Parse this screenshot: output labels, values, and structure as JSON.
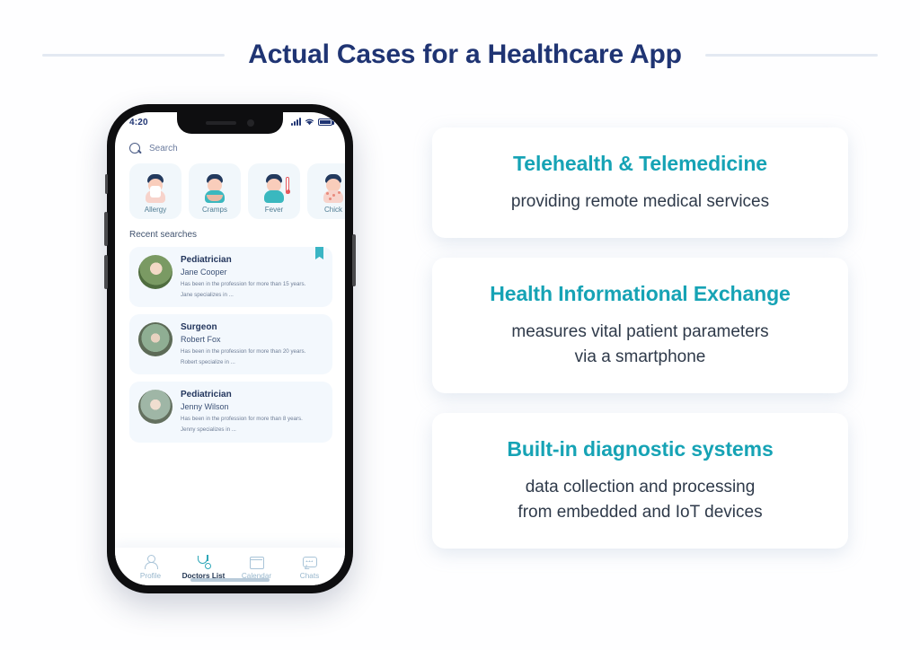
{
  "header": {
    "title": "Actual Cases for a Healthcare App"
  },
  "phone": {
    "status": {
      "time": "4:20",
      "cellular_icon": "cellular-bars-icon",
      "wifi_icon": "wifi-icon",
      "battery_icon": "battery-icon"
    },
    "search": {
      "icon": "search-icon",
      "placeholder": "Search",
      "value": ""
    },
    "symptoms": [
      {
        "label": "Allergy",
        "icon": "sneezing-boy-icon"
      },
      {
        "label": "Cramps",
        "icon": "stomach-ache-boy-icon"
      },
      {
        "label": "Fever",
        "icon": "fever-thermometer-icon"
      },
      {
        "label": "Chick",
        "icon": "chickenpox-rash-icon"
      }
    ],
    "recent": {
      "title": "Recent searches",
      "doctors": [
        {
          "specialty": "Pediatrician",
          "name": "Jane Cooper",
          "desc_line1": "Has been in the profession for more than 15 years.",
          "desc_line2": "Jane specializes in ...",
          "bookmarked": true
        },
        {
          "specialty": "Surgeon",
          "name": "Robert Fox",
          "desc_line1": "Has been in the profession for more than 20 years.",
          "desc_line2": "Robert specialize in ...",
          "bookmarked": false
        },
        {
          "specialty": "Pediatrician",
          "name": "Jenny Wilson",
          "desc_line1": "Has been in the profession for more than 8 years.",
          "desc_line2": "Jenny specializes in ...",
          "bookmarked": false
        }
      ]
    },
    "tabs": [
      {
        "label": "Profile",
        "icon": "person-icon",
        "active": false
      },
      {
        "label": "Doctors List",
        "icon": "stethoscope-icon",
        "active": true
      },
      {
        "label": "Calendar",
        "icon": "calendar-icon",
        "active": false
      },
      {
        "label": "Chats",
        "icon": "chat-bubble-icon",
        "active": false
      }
    ]
  },
  "cards": [
    {
      "title": "Telehealth & Telemedicine",
      "body_line1": "providing remote medical services",
      "body_line2": ""
    },
    {
      "title": "Health Informational Exchange",
      "body_line1": "measures vital patient parameters",
      "body_line2": "via a smartphone"
    },
    {
      "title": "Built-in diagnostic systems",
      "body_line1": "data collection and processing",
      "body_line2": "from embedded and IoT devices"
    }
  ],
  "colors": {
    "title_navy": "#1f3473",
    "accent_teal": "#16a3b5",
    "card_bg": "#ffffff",
    "page_bg": "#fefeff",
    "rule": "#e3e9f2"
  }
}
